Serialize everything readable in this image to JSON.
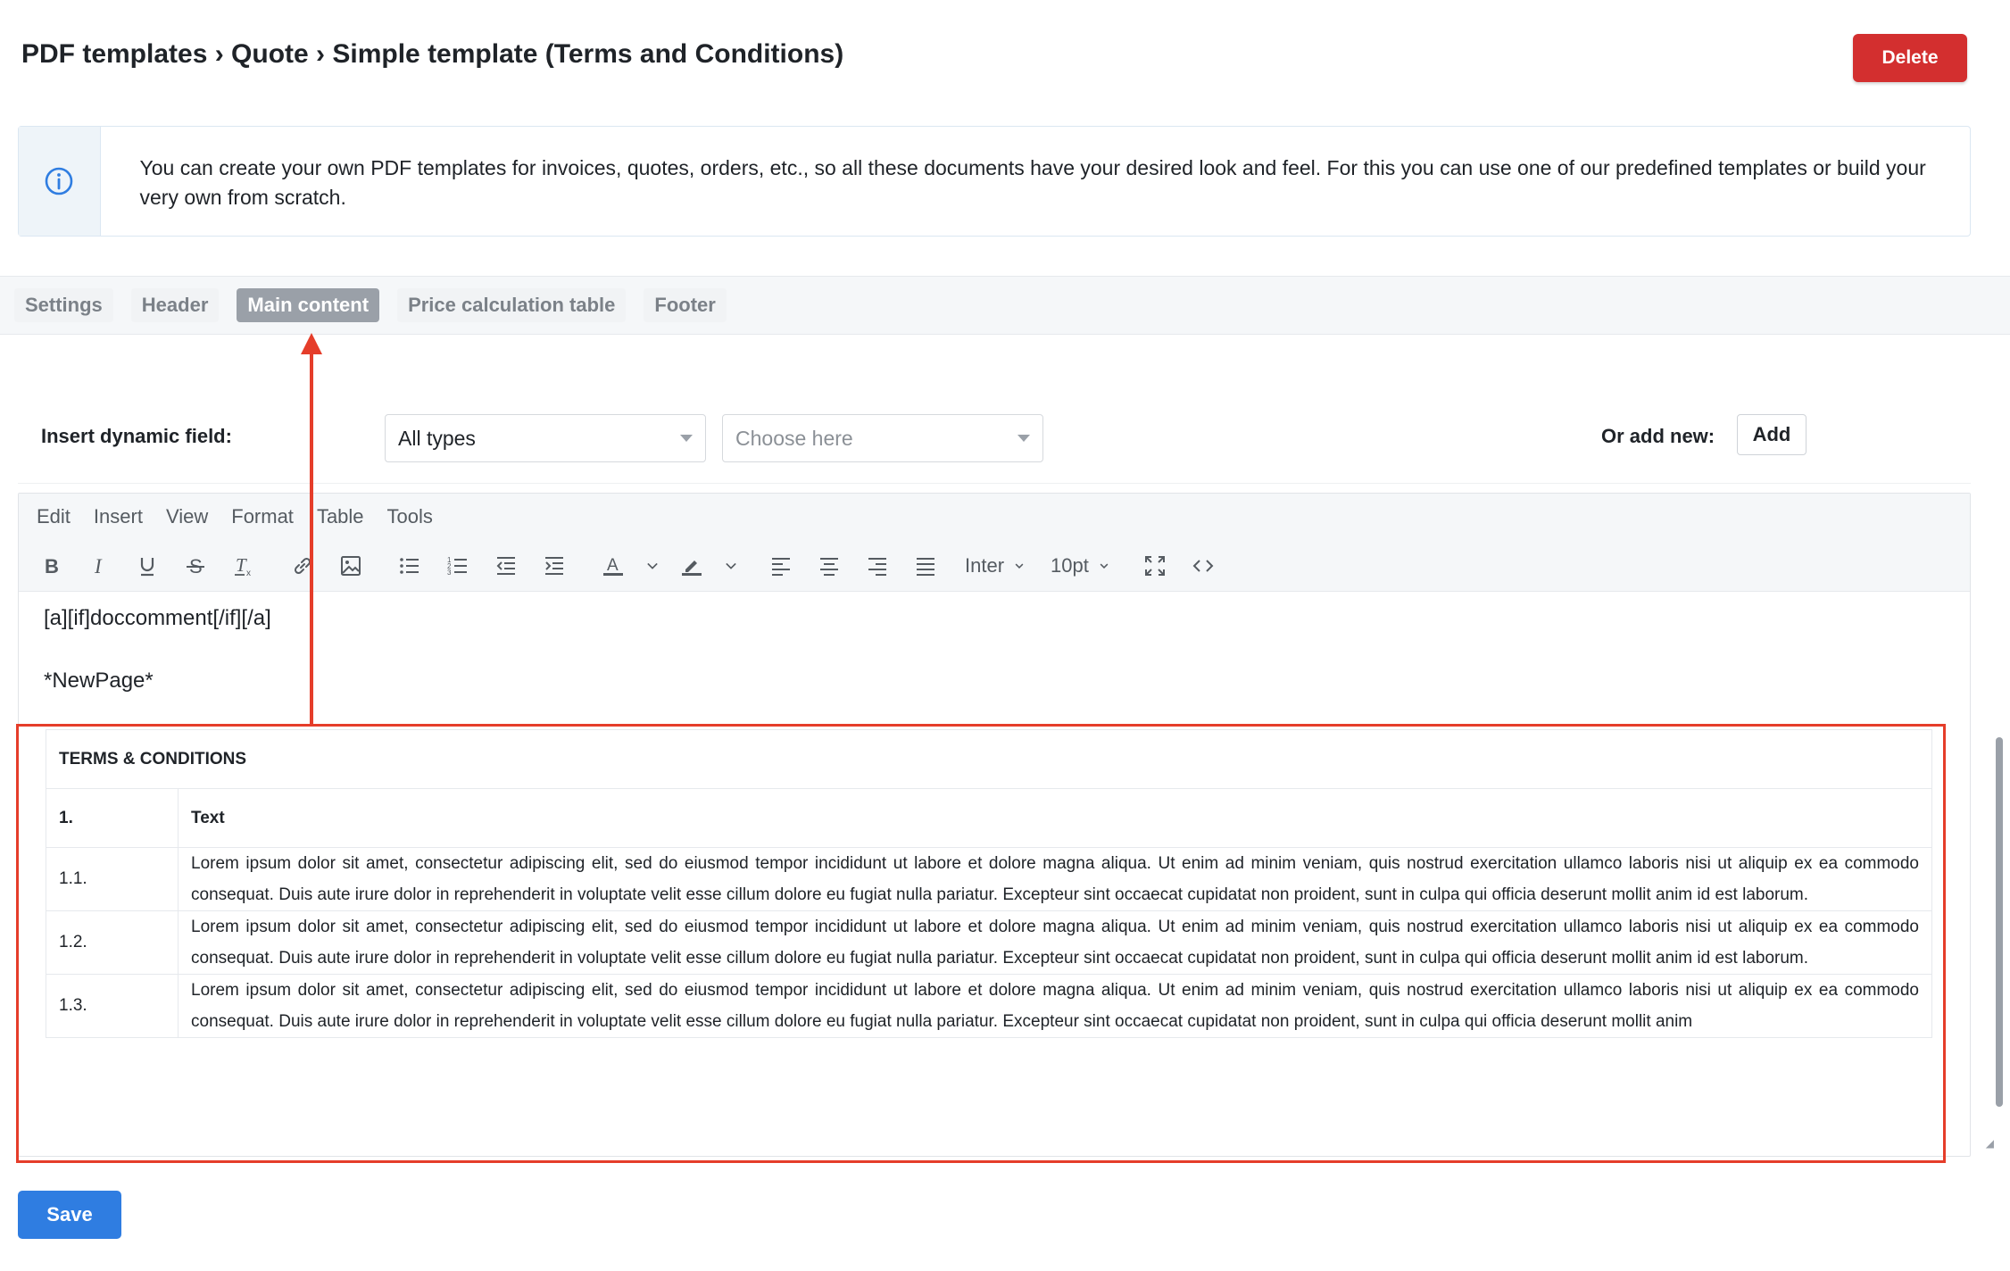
{
  "header": {
    "breadcrumb": "PDF templates › Quote › Simple template (Terms and Conditions)",
    "delete_label": "Delete"
  },
  "info": {
    "text": "You can create your own PDF templates for invoices, quotes, orders, etc., so all these documents have your desired look and feel. For this you can use one of our predefined templates or build your very own from scratch."
  },
  "tabs": [
    {
      "label": "Settings",
      "active": false
    },
    {
      "label": "Header",
      "active": false
    },
    {
      "label": "Main content",
      "active": true
    },
    {
      "label": "Price calculation table",
      "active": false
    },
    {
      "label": "Footer",
      "active": false
    }
  ],
  "dynamic_field": {
    "label": "Insert dynamic field:",
    "type_select": "All types",
    "field_placeholder": "Choose here",
    "or_add_label": "Or add new:",
    "add_label": "Add"
  },
  "editor": {
    "menu": [
      "Edit",
      "Insert",
      "View",
      "Format",
      "Table",
      "Tools"
    ],
    "font": "Inter",
    "font_size": "10pt",
    "content_line1": "[a][if]doccomment[/if][/a]",
    "content_line2": "*NewPage*",
    "table": {
      "title": "TERMS & CONDITIONS",
      "header_num": "1.",
      "header_text": "Text",
      "rows": [
        {
          "num": "1.1.",
          "text": "Lorem ipsum dolor sit amet, consectetur adipiscing elit, sed do eiusmod tempor incididunt ut labore et dolore magna aliqua. Ut enim ad minim veniam, quis nostrud exercitation ullamco laboris nisi ut aliquip ex ea commodo consequat. Duis aute irure dolor in reprehenderit in voluptate velit esse cillum dolore eu fugiat nulla pariatur. Excepteur sint occaecat cupidatat non proident, sunt in culpa qui officia deserunt mollit anim id est laborum."
        },
        {
          "num": "1.2.",
          "text": "Lorem ipsum dolor sit amet, consectetur adipiscing elit, sed do eiusmod tempor incididunt ut labore et dolore magna aliqua. Ut enim ad minim veniam, quis nostrud exercitation ullamco laboris nisi ut aliquip ex ea commodo consequat. Duis aute irure dolor in reprehenderit in voluptate velit esse cillum dolore eu fugiat nulla pariatur. Excepteur sint occaecat cupidatat non proident, sunt in culpa qui officia deserunt mollit anim id est laborum."
        },
        {
          "num": "1.3.",
          "text": "Lorem ipsum dolor sit amet, consectetur adipiscing elit, sed do eiusmod tempor incididunt ut labore et dolore magna aliqua. Ut enim ad minim veniam, quis nostrud exercitation ullamco laboris nisi ut aliquip ex ea commodo consequat. Duis aute irure dolor in reprehenderit in voluptate velit esse cillum dolore eu fugiat nulla pariatur. Excepteur sint occaecat cupidatat non proident, sunt in culpa qui officia deserunt mollit anim"
        }
      ]
    }
  },
  "footer": {
    "save_label": "Save"
  },
  "colors": {
    "delete": "#d32f2f",
    "save": "#2f7de1",
    "highlight": "#e53d2a",
    "active_tab": "#9aa0a8"
  }
}
